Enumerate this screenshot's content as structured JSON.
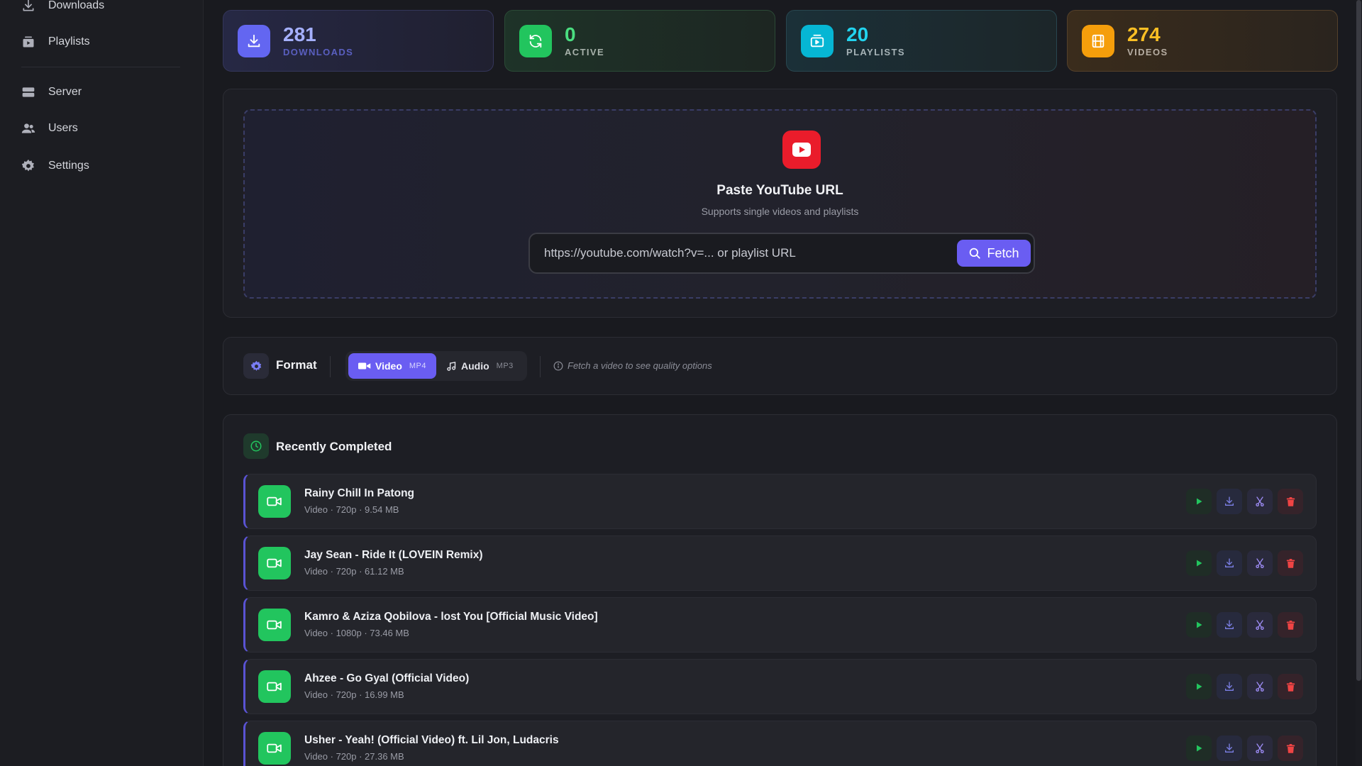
{
  "sidebar": {
    "items": [
      {
        "label": "Downloads",
        "icon": "download-icon"
      },
      {
        "label": "Playlists",
        "icon": "playlist-icon"
      },
      {
        "label": "Server",
        "icon": "server-icon"
      },
      {
        "label": "Users",
        "icon": "users-icon"
      },
      {
        "label": "Settings",
        "icon": "gear-icon"
      }
    ]
  },
  "stats": [
    {
      "value": "281",
      "label": "DOWNLOADS",
      "icon": "download-icon",
      "accent": "#6366f1"
    },
    {
      "value": "0",
      "label": "ACTIVE",
      "icon": "refresh-icon",
      "accent": "#22c55e"
    },
    {
      "value": "20",
      "label": "PLAYLISTS",
      "icon": "playlist-icon",
      "accent": "#06b6d4"
    },
    {
      "value": "274",
      "label": "VIDEOS",
      "icon": "film-icon",
      "accent": "#f59e0b"
    }
  ],
  "url_panel": {
    "title": "Paste YouTube URL",
    "subtitle": "Supports single videos and playlists",
    "placeholder": "https://youtube.com/watch?v=... or playlist URL",
    "fetch_label": "Fetch"
  },
  "format": {
    "title": "Format",
    "video_label": "Video",
    "video_tag": "MP4",
    "audio_label": "Audio",
    "audio_tag": "MP3",
    "hint": "Fetch a video to see quality options",
    "selected": "Video"
  },
  "recent": {
    "title": "Recently Completed",
    "items": [
      {
        "title": "Rainy Chill In Patong",
        "meta": "Video · 720p · 9.54 MB"
      },
      {
        "title": "Jay Sean - Ride It (LOVEIN Remix)",
        "meta": "Video · 720p · 61.12 MB"
      },
      {
        "title": "Kamro & Aziza Qobilova - lost You [Official Music Video]",
        "meta": "Video · 1080p · 73.46 MB"
      },
      {
        "title": "Ahzee - Go Gyal (Official Video)",
        "meta": "Video · 720p · 16.99 MB"
      },
      {
        "title": "Usher - Yeah! (Official Video) ft. Lil Jon, Ludacris",
        "meta": "Video · 720p · 27.36 MB"
      }
    ]
  },
  "colors": {
    "accent": "#6a5df2",
    "success": "#22c55e",
    "danger": "#ef4444",
    "youtube": "#ea1c2b"
  }
}
